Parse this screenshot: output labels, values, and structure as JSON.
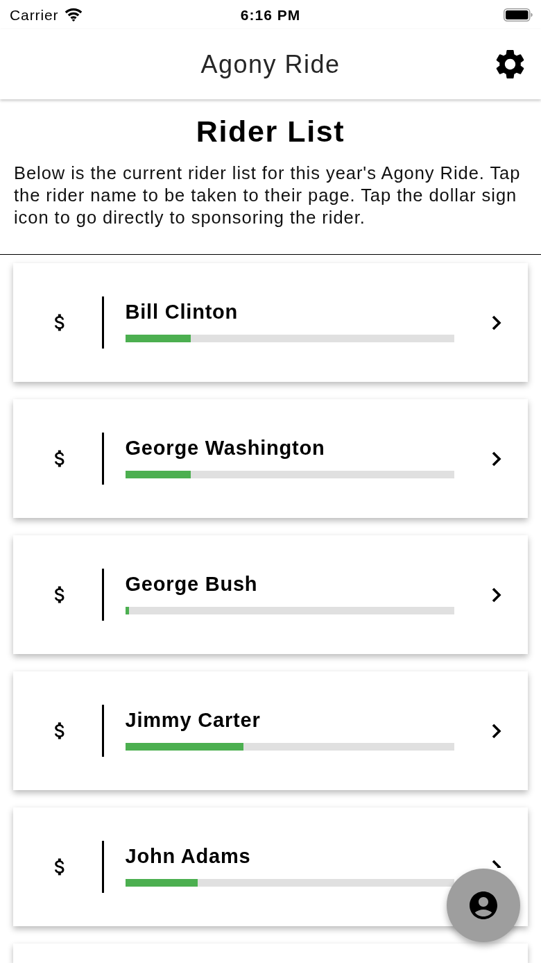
{
  "status_bar": {
    "carrier": "Carrier",
    "time": "6:16 PM"
  },
  "app_bar": {
    "title": "Agony Ride"
  },
  "page": {
    "title": "Rider List",
    "description": "Below is the current rider list for this year's Agony Ride. Tap the rider name to be taken to their page. Tap the dollar sign icon to go directly to sponsoring the rider."
  },
  "riders": [
    {
      "name": "Bill Clinton",
      "level": 0.2
    },
    {
      "name": "George Washington",
      "level": 0.2
    },
    {
      "name": "George Bush",
      "level": 0.011
    },
    {
      "name": "Jimmy Carter",
      "level": 0.36
    },
    {
      "name": "John Adams",
      "level": 0.22
    }
  ]
}
